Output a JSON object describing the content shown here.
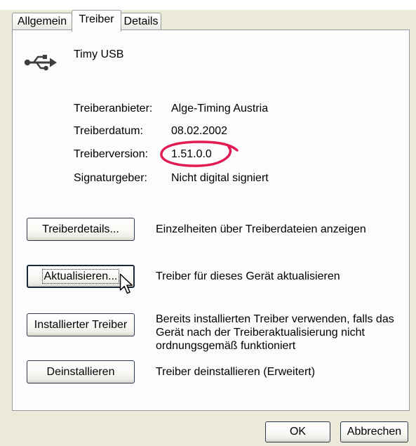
{
  "tabs": [
    {
      "label": "Allgemein",
      "selected": false
    },
    {
      "label": "Treiber",
      "selected": true
    },
    {
      "label": "Details",
      "selected": false
    }
  ],
  "device": {
    "icon": "usb-icon",
    "name": "Timy USB"
  },
  "driver_info": [
    {
      "label": "Treiberanbieter:",
      "value": "Alge-Timing Austria"
    },
    {
      "label": "Treiberdatum:",
      "value": "08.02.2002"
    },
    {
      "label": "Treiberversion:",
      "value": "1.51.0.0",
      "annotated": true
    },
    {
      "label": "Signaturgeber:",
      "value": "Nicht digital signiert"
    }
  ],
  "actions": [
    {
      "button": "Treiberdetails...",
      "description": "Einzelheiten über Treiberdateien anzeigen",
      "focused": false
    },
    {
      "button": "Aktualisieren...",
      "description": "Treiber für dieses Gerät aktualisieren",
      "focused": true
    },
    {
      "button": "Installierter Treiber",
      "description": "Bereits installierten Treiber verwenden, falls das Gerät nach der Treiberaktualisierung nicht ordnungsgemäß funktioniert",
      "focused": false
    },
    {
      "button": "Deinstallieren",
      "description": "Treiber deinstallieren (Erweitert)",
      "focused": false
    }
  ],
  "footer": {
    "ok_label": "OK",
    "cancel_label": "Abbrechen"
  },
  "cursor": {
    "icon": "mouse-cursor-icon"
  },
  "annotation": {
    "color": "#E21B55"
  },
  "colors": {
    "dialog_bg": "#ECE9D8",
    "panel_bg": "#FCFCFE",
    "panel_border": "#919B9C"
  }
}
